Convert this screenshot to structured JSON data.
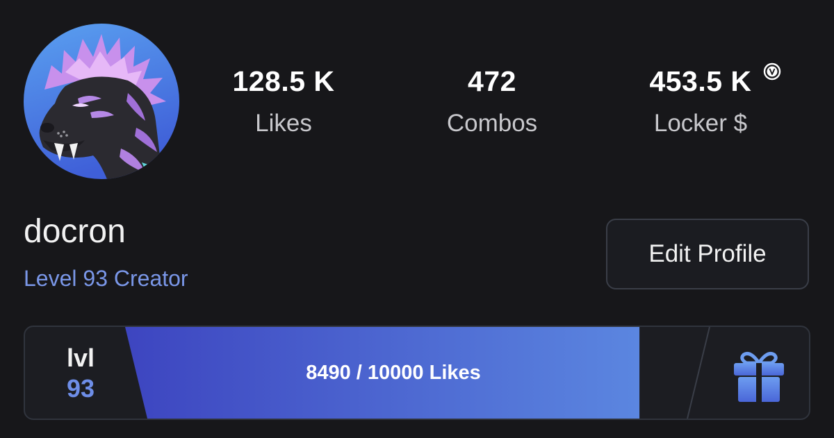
{
  "profile": {
    "username": "docron",
    "level_title": "Level 93 Creator",
    "edit_label": "Edit Profile"
  },
  "stats": {
    "likes": {
      "value": "128.5 K",
      "label": "Likes"
    },
    "combos": {
      "value": "472",
      "label": "Combos"
    },
    "locker": {
      "value": "453.5 K",
      "label": "Locker $",
      "currency_icon": "v-bucks-icon"
    }
  },
  "level": {
    "prefix": "lvl",
    "number": "93",
    "progress_text": "8490 / 10000 Likes",
    "progress_fraction": 0.849,
    "reward_icon": "gift-icon"
  },
  "colors": {
    "background": "#17171a",
    "accent_blue": "#7a97e8",
    "progress_start": "#3d45c0",
    "progress_end": "#5b86e0"
  }
}
